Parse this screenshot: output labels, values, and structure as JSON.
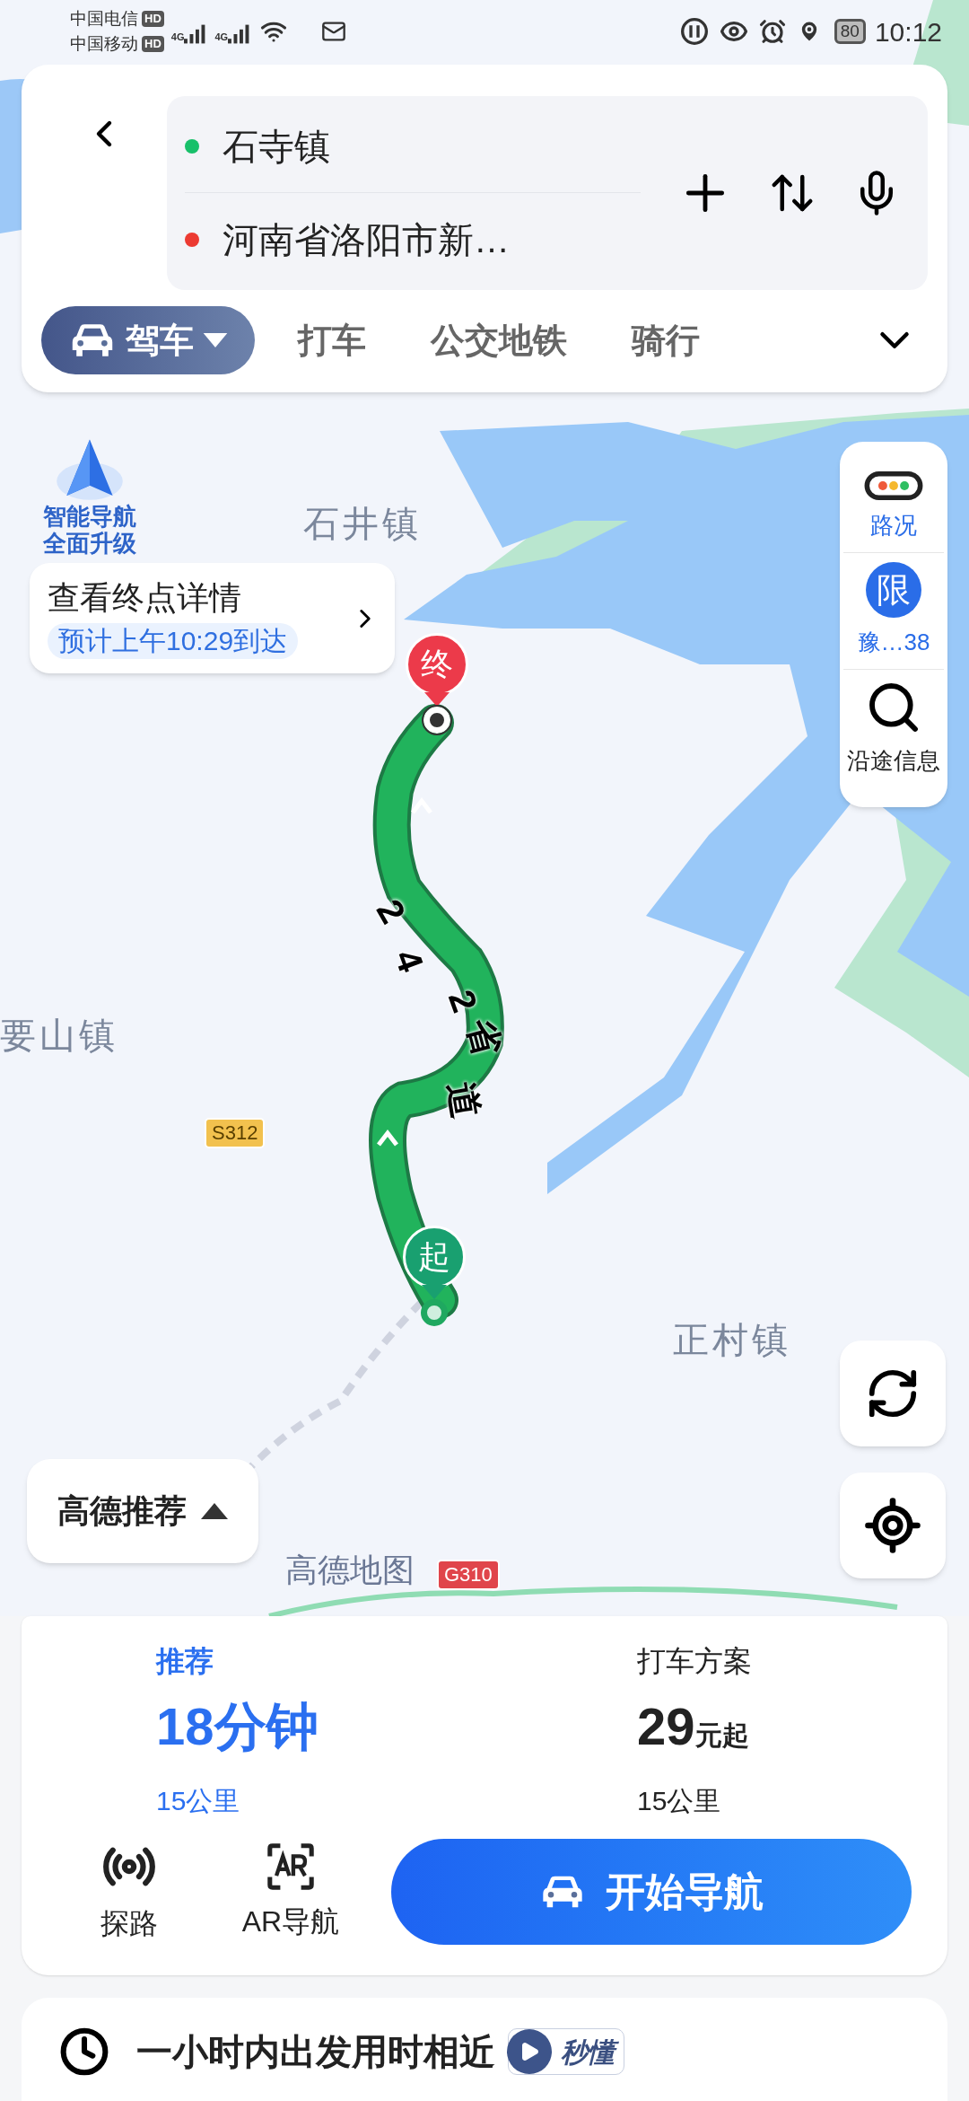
{
  "status_bar": {
    "carriers": [
      {
        "name": "中国电信",
        "badge": "HD",
        "network": "4G"
      },
      {
        "name": "中国移动",
        "badge": "HD",
        "network": "4G"
      }
    ],
    "battery": "80",
    "time": "10:12"
  },
  "route_inputs": [
    {
      "kind": "start",
      "text": "石寺镇"
    },
    {
      "kind": "end",
      "text": "河南省洛阳市新…"
    }
  ],
  "modes": [
    {
      "label": "驾车",
      "selected": true
    },
    {
      "label": "打车",
      "selected": false
    },
    {
      "label": "公交地铁",
      "selected": false
    },
    {
      "label": "骑行",
      "selected": false
    }
  ],
  "promo": {
    "line1": "智能导航",
    "line2": "全面升级"
  },
  "destination_callout": {
    "title": "查看终点详情",
    "eta": "预计上午10:29到达"
  },
  "pins": [
    {
      "kind": "end",
      "label": "终"
    },
    {
      "kind": "start",
      "label": "起"
    }
  ],
  "road_label": "242省道",
  "map_labels": [
    {
      "kind": "town",
      "text": "石井镇"
    },
    {
      "kind": "town",
      "text": "要山镇"
    },
    {
      "kind": "town",
      "text": "正村镇"
    },
    {
      "kind": "shield",
      "text": "S312",
      "color": "#f2c14e"
    },
    {
      "kind": "shield",
      "text": "G310",
      "color": "#e0454b"
    },
    {
      "kind": "brand",
      "text": "高德地图"
    }
  ],
  "side_tools": [
    {
      "kind": "traffic",
      "label": "路况"
    },
    {
      "kind": "restriction",
      "badge": "限",
      "label": "豫…38"
    },
    {
      "kind": "search",
      "label": "沿途信息"
    }
  ],
  "recommend_button": "高德推荐",
  "plans": [
    {
      "kind": "route",
      "label": "推荐",
      "main": "18分钟",
      "distance": "15公里",
      "selected": true
    },
    {
      "kind": "taxi",
      "label": "打车方案",
      "main": "29",
      "unit": "元起",
      "distance": "15公里",
      "selected": false
    }
  ],
  "actions": [
    {
      "kind": "probe",
      "label": "探路"
    },
    {
      "kind": "ar",
      "label": "AR导航"
    }
  ],
  "start_button": "开始导航",
  "tip": {
    "text": "一小时内出发用时相近",
    "badge": "秒懂"
  }
}
